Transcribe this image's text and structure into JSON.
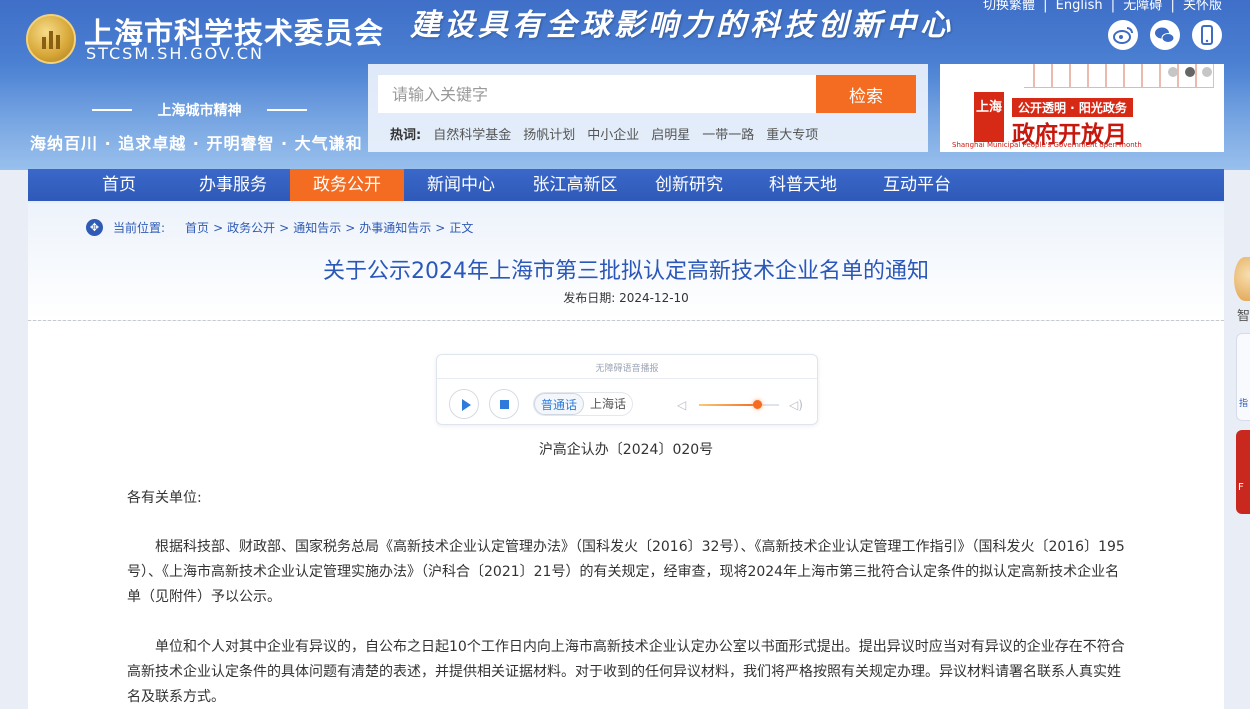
{
  "header": {
    "site_title": "上海市科学技术委员会",
    "site_domain": "STCSM.SH.GOV.CN",
    "slogan": "建设具有全球影响力的科技创新中心",
    "top_links": [
      "切换繁體",
      "English",
      "无障碍",
      "关怀版"
    ],
    "top_links_sep": "|",
    "social_icons": [
      "weibo-icon",
      "wechat-icon",
      "mobile-icon"
    ],
    "city_spirit_title": "上海城市精神",
    "city_spirit_text": "海纳百川 · 追求卓越 · 开明睿智 · 大气谦和"
  },
  "search": {
    "placeholder": "请输入关键字",
    "button_label": "检索",
    "hot_label": "热词:",
    "hot_words": [
      "自然科学基金",
      "扬帆计划",
      "中小企业",
      "启明星",
      "一带一路",
      "重大专项"
    ]
  },
  "banner": {
    "badge": "上海",
    "line1": "公开透明 · 阳光政务",
    "line2": "政府开放月",
    "line3": "Shanghai Municipal People's Government open month",
    "slides_total": 3,
    "slide_active": 2
  },
  "nav": {
    "items": [
      "首页",
      "办事服务",
      "政务公开",
      "新闻中心",
      "张江高新区",
      "创新研究",
      "科普天地",
      "互动平台"
    ],
    "active_index": 2
  },
  "breadcrumb": {
    "label": "当前位置:",
    "items": [
      "首页",
      "政务公开",
      "通知告示",
      "办事通知告示",
      "正文"
    ],
    "sep": ">"
  },
  "article": {
    "title": "关于公示2024年上海市第三批拟认定高新技术企业名单的通知",
    "date_label": "发布日期:",
    "date": "2024-12-10",
    "doc_number": "沪高企认办〔2024〕020号",
    "salutation": "各有关单位:",
    "paragraphs": [
      "根据科技部、财政部、国家税务总局《高新技术企业认定管理办法》（国科发火〔2016〕32号）、《高新技术企业认定管理工作指引》（国科发火〔2016〕195号）、《上海市高新技术企业认定管理实施办法》（沪科合〔2021〕21号）的有关规定，经审查，现将2024年上海市第三批符合认定条件的拟认定高新技术企业名单（见附件）予以公示。",
      "单位和个人对其中企业有异议的，自公布之日起10个工作日内向上海市高新技术企业认定办公室以书面形式提出。提出异议时应当对有异议的企业存在不符合高新技术企业认定条件的具体问题有清楚的表述，并提供相关证据材料。对于收到的任何异议材料，我们将严格按照有关规定办理。异议材料请署名联系人真实姓名及联系方式。"
    ]
  },
  "audio_player": {
    "title": "无障碍语音播报",
    "lang_options": [
      "普通话",
      "上海话"
    ],
    "lang_selected": 0,
    "volume": 0.72
  },
  "side": {
    "ai_char": "智",
    "widget_char": "指",
    "red_char": "F"
  }
}
